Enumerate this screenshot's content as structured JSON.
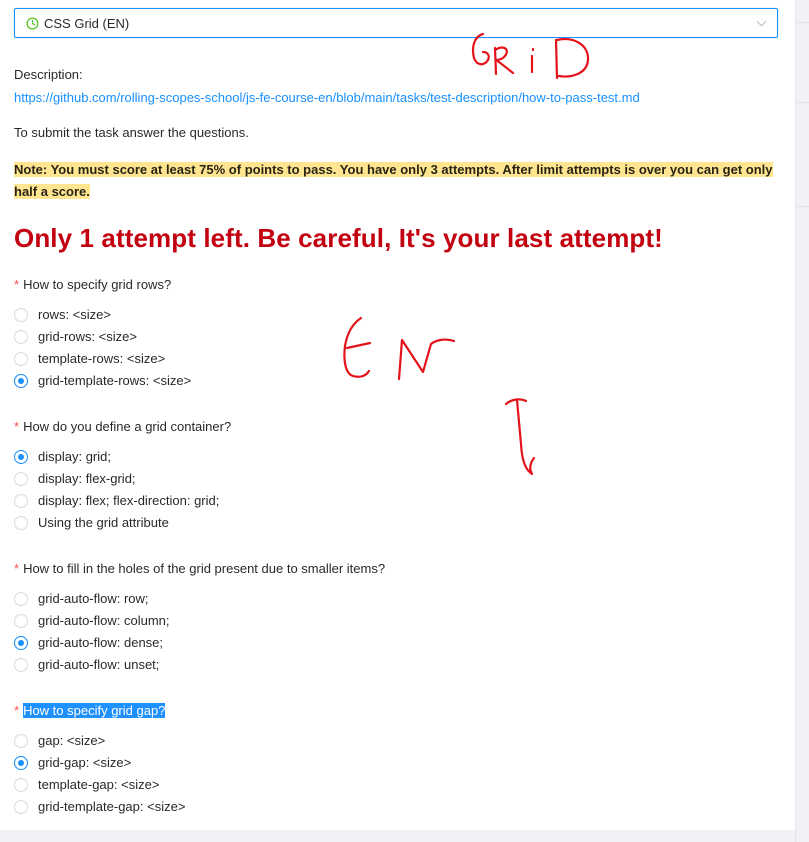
{
  "select": {
    "value": "CSS Grid (EN)",
    "clock_icon": "clock-circle-icon",
    "chevron_icon": "chevron-down-icon"
  },
  "description": {
    "label": "Description:",
    "link": "https://github.com/rolling-scopes-school/js-fe-course-en/blob/main/tasks/test-description/how-to-pass-test.md"
  },
  "submit_text": "To submit the task answer the questions.",
  "note": "Note: You must score at least 75% of points to pass. You have only 3 attempts. After limit attempts is over you can get only half a score.",
  "warning": "Only 1 attempt left. Be careful, It's your last attempt!",
  "required_mark": "*",
  "questions": [
    {
      "title": "How to specify grid rows?",
      "options": [
        "rows: <size>",
        "grid-rows: <size>",
        "template-rows: <size>",
        "grid-template-rows: <size>"
      ],
      "selected_index": 3
    },
    {
      "title": "How do you define a grid container?",
      "options": [
        "display: grid;",
        "display: flex-grid;",
        "display: flex; flex-direction: grid;",
        "Using the grid attribute"
      ],
      "selected_index": 0
    },
    {
      "title": "How to fill in the holes of the grid present due to smaller items?",
      "options": [
        "grid-auto-flow: row;",
        "grid-auto-flow: column;",
        "grid-auto-flow: dense;",
        "grid-auto-flow: unset;"
      ],
      "selected_index": 2
    },
    {
      "title": "How to specify grid gap?",
      "options": [
        "gap: <size>",
        "grid-gap: <size>",
        "template-gap: <size>",
        "grid-template-gap: <size>"
      ],
      "selected_index": 1,
      "title_highlighted": true
    }
  ],
  "annotations": {
    "handwriting_1": "GRID",
    "handwriting_2": "EN",
    "color": "#e3121b"
  },
  "colors": {
    "accent": "#1890ff",
    "warning": "#c30010",
    "note_bg": "#ffe58f",
    "selection": "#1e90ff"
  }
}
